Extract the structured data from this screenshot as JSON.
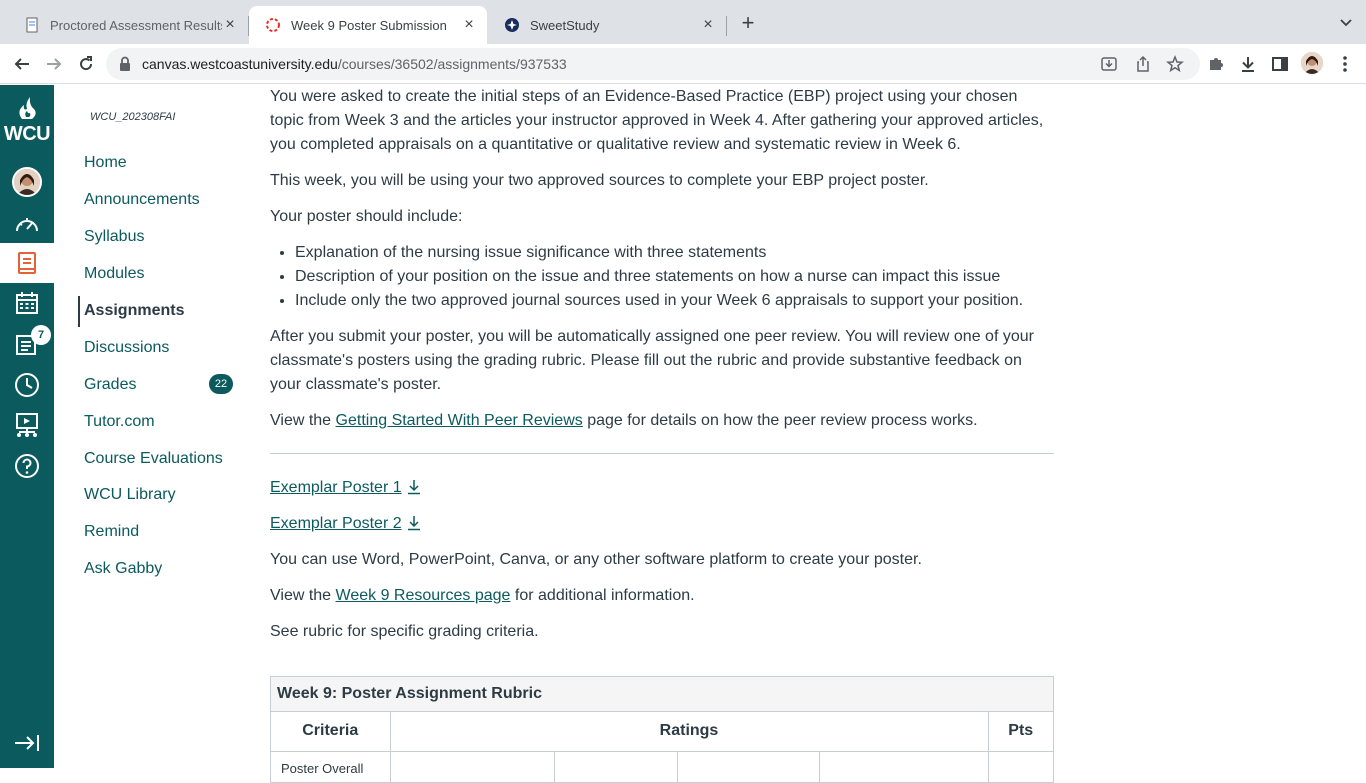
{
  "browser": {
    "tabs": [
      {
        "title": "Proctored Assessment Results",
        "active": false
      },
      {
        "title": "Week 9 Poster Submission",
        "active": true
      },
      {
        "title": "SweetStudy",
        "active": false
      }
    ],
    "url_host": "canvas.westcoastuniversity.edu",
    "url_path": "/courses/36502/assignments/937533"
  },
  "global_nav": {
    "logo": "WCU",
    "items": [
      {
        "icon": "account-avatar-icon"
      },
      {
        "icon": "dashboard-icon"
      },
      {
        "icon": "courses-icon",
        "active": true
      },
      {
        "icon": "calendar-icon"
      },
      {
        "icon": "inbox-icon",
        "badge": "7"
      },
      {
        "icon": "history-icon"
      },
      {
        "icon": "commons-icon"
      },
      {
        "icon": "help-icon"
      }
    ],
    "collapse_icon": "collapse-nav-icon"
  },
  "course_nav": {
    "course_code": "WCU_202308FAI",
    "items": [
      {
        "label": "Home"
      },
      {
        "label": "Announcements"
      },
      {
        "label": "Syllabus"
      },
      {
        "label": "Modules"
      },
      {
        "label": "Assignments",
        "active": true
      },
      {
        "label": "Discussions"
      },
      {
        "label": "Grades",
        "badge": "22"
      },
      {
        "label": "Tutor.com"
      },
      {
        "label": "Course Evaluations"
      },
      {
        "label": "WCU Library"
      },
      {
        "label": "Remind"
      },
      {
        "label": "Ask Gabby"
      }
    ]
  },
  "content": {
    "p1": "You were asked to create the initial steps of an Evidence-Based Practice (EBP) project using your chosen topic from Week 3 and the articles your instructor approved in Week 4. After gathering your approved articles, you completed appraisals on a quantitative or qualitative review and systematic review in Week 6.",
    "p2": "This week, you will be using your two approved sources to complete your EBP project poster.",
    "p3": "Your poster should include:",
    "bullets": [
      "Explanation of the nursing issue significance with three statements",
      "Description of your position on the issue and three statements on how a nurse can impact this issue",
      "Include only the two approved journal sources used in your Week 6 appraisals to support your position."
    ],
    "p4": "After you submit your poster, you will be automatically assigned one peer review. You will review one of your classmate's posters using the grading rubric. Please fill out the rubric and provide substantive feedback on your classmate's poster.",
    "p5_pre": "View the ",
    "p5_link": "Getting Started With Peer Reviews",
    "p5_post": " page for details on how the peer review process works.",
    "exemplar1": "Exemplar Poster 1",
    "exemplar2": "Exemplar Poster 2",
    "p6": "You can use Word, PowerPoint, Canva, or any other software platform to create your poster.",
    "p7_pre": "View the ",
    "p7_link": "Week 9 Resources page",
    "p7_post": " for additional information.",
    "p8": "See rubric for specific grading criteria."
  },
  "rubric": {
    "title": "Week 9: Poster Assignment Rubric",
    "headers": [
      "Criteria",
      "Ratings",
      "Pts"
    ],
    "first_row_criteria": "Poster Overall"
  },
  "colors": {
    "brand": "#0b5a5e",
    "text": "#2d3b45"
  }
}
